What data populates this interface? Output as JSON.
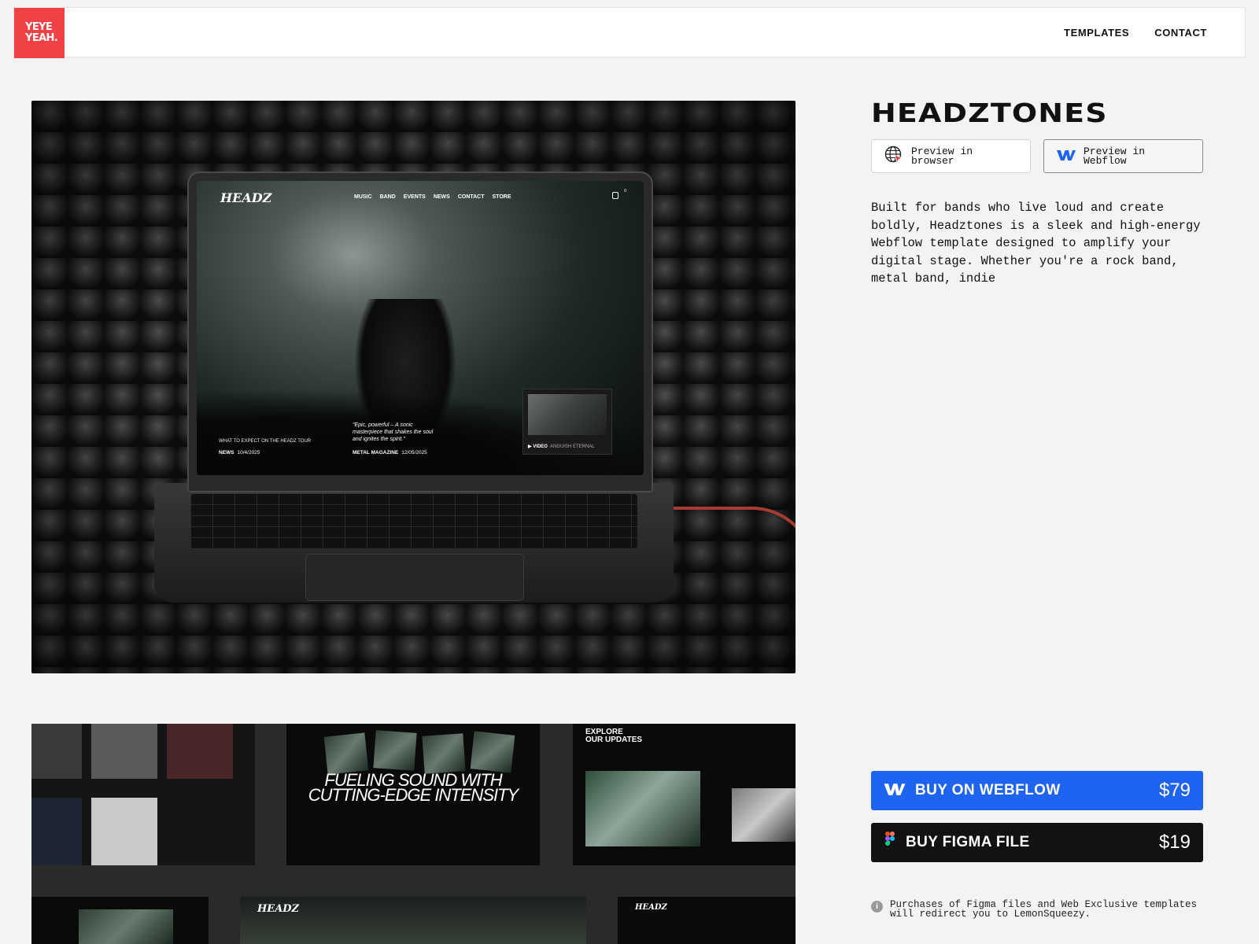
{
  "header": {
    "logo_line1": "YEYE",
    "logo_line2": "YEAH.",
    "nav": [
      "TEMPLATES",
      "CONTACT"
    ]
  },
  "hero_mockup": {
    "site_logo": "HEADZ",
    "site_nav": [
      "MUSIC",
      "BAND",
      "EVENTS",
      "NEWS",
      "CONTACT",
      "STORE"
    ],
    "cart_count": "0",
    "news_title": "WHAT TO EXPECT ON THE HEADZ TOUR",
    "news_label": "NEWS",
    "news_date": "10/4/2025",
    "quote": "\"Epic, powerful – A sonic masterpiece that shakes the soul and ignites the spirit.\"",
    "magazine_label": "METAL MAGAZINE",
    "magazine_date": "12/05/2025",
    "video_label": "VIDEO",
    "video_title": "ANGUISH ETERNAL"
  },
  "strip": {
    "fuel_text": "FUELING SOUND WITH CUTTING-EDGE INTENSITY",
    "explore_line1": "EXPLORE",
    "explore_line2": "OUR UPDATES",
    "mini_logo": "HEADZ"
  },
  "product": {
    "title": "HEADZTONES",
    "preview_browser": "Preview in browser",
    "preview_webflow": "Preview in Webflow",
    "description": "Built for bands who live loud and create boldly, Headztones is a sleek and high-energy Webflow template designed to amplify your digital stage. Whether you're a rock band, metal band, indie",
    "buy_webflow_label": "BUY ON WEBFLOW",
    "buy_webflow_price": "$79",
    "buy_figma_label": "BUY FIGMA FILE",
    "buy_figma_price": "$19",
    "note": "Purchases of Figma files and Web Exclusive templates will redirect you to LemonSqueezy."
  },
  "colors": {
    "logo_red": "#f04147",
    "webflow_blue": "#1e64f0",
    "figma_dark": "#121212"
  },
  "icons": [
    "globe-cursor-icon",
    "webflow-icon",
    "figma-icon",
    "info-icon"
  ]
}
